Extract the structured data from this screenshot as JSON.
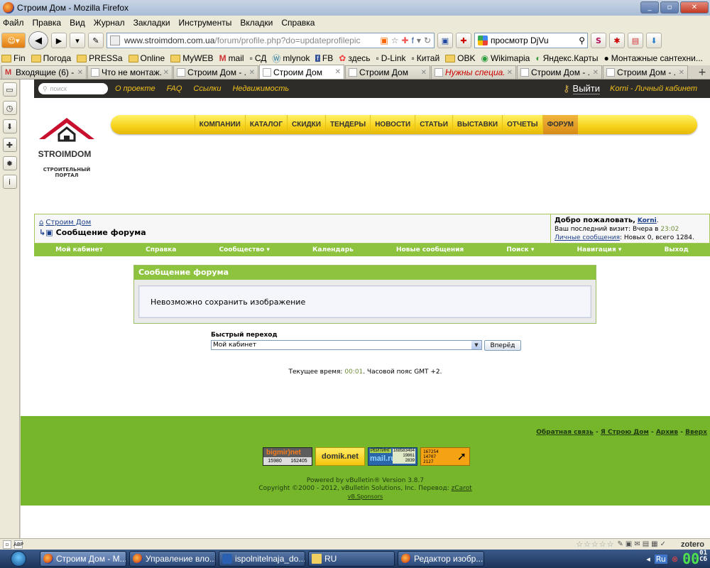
{
  "window": {
    "title": "Строим Дом - Mozilla Firefox"
  },
  "menubar": [
    "Файл",
    "Правка",
    "Вид",
    "Журнал",
    "Закладки",
    "Инструменты",
    "Вкладки",
    "Справка"
  ],
  "navbar": {
    "url_host": "www.stroimdom.com.ua",
    "url_path": "/forum/profile.php?do=updateprofilepic",
    "search_value": "просмотр DjVu"
  },
  "bookmarks": [
    "Fin",
    "Погода",
    "PRESSa",
    "Online",
    "MyWEB",
    "mail",
    "СД",
    "mlynok",
    "FB",
    "здесь",
    "D-Link",
    "Китай",
    "OBK",
    "Wikimapia",
    "Яндекс.Карты",
    "Монтажные сантехни..."
  ],
  "tabs": [
    {
      "label": "Входящие (6) - ...",
      "icon": "gmail-icon",
      "active": false,
      "red": false
    },
    {
      "label": "Что не монтаж...",
      "icon": "page-icon",
      "active": false,
      "red": false
    },
    {
      "label": "Строим Дом - ...",
      "icon": "page-icon",
      "active": false,
      "red": false
    },
    {
      "label": "Строим Дом",
      "icon": "page-icon",
      "active": true,
      "red": false
    },
    {
      "label": "Строим Дом",
      "icon": "page-icon",
      "active": false,
      "red": false
    },
    {
      "label": "Нужны специа...",
      "icon": "page-icon",
      "active": false,
      "red": true
    },
    {
      "label": "Строим Дом - ...",
      "icon": "page-icon",
      "active": false,
      "red": false
    },
    {
      "label": "Строим Дом - ...",
      "icon": "page-icon",
      "active": false,
      "red": false
    }
  ],
  "site": {
    "top": {
      "search_placeholder": "поиск",
      "links": [
        "О проекте",
        "FAQ",
        "Ссылки",
        "Недвижимость"
      ],
      "exit": "Выйти",
      "cabinet": "Korni - Личный кабинет"
    },
    "logo": {
      "brand": "STROIMDOM",
      "sub": "СТРОИТЕЛЬНЫЙ ПОРТАЛ"
    },
    "menu": [
      "КОМПАНИИ",
      "КАТАЛОГ",
      "СКИДКИ",
      "ТЕНДЕРЫ",
      "НОВОСТИ",
      "СТАТЬИ",
      "ВЫСТАВКИ",
      "ОТЧЕТЫ",
      "ФОРУМ"
    ],
    "menu_active": "ФОРУМ"
  },
  "forum": {
    "breadcrumb_home": "Строим Дом",
    "breadcrumb_current": "Сообщение форума",
    "welcome_prefix": "Добро пожаловать,",
    "username": "Korni",
    "last_visit_label": "Ваш последний визит: Вчера в",
    "last_visit_time": "23:02",
    "pm_link": "Личные сообщения",
    "pm_text": ": Новых 0, всего 1284.",
    "nav": [
      "Мой кабинет",
      "Справка",
      "Сообщество ▾",
      "Календарь",
      "Новые сообщения",
      "Поиск ▾",
      "Навигация ▾",
      "Выход"
    ],
    "message_title": "Сообщение форума",
    "message_text": "Невозможно сохранить изображение",
    "quick_jump_label": "Быстрый переход",
    "quick_jump_value": "Мой кабинет",
    "quick_jump_button": "Вперёд",
    "time_prefix": "Текущее время:",
    "time_value": "00:01",
    "time_suffix": ". Часовой пояс GMT +2."
  },
  "footer": {
    "links": [
      "Обратная связь",
      "Я Строю Дом",
      "Архив",
      "Вверх"
    ],
    "counters": {
      "bigmir": {
        "title": "bigmir)net",
        "a": "15980",
        "b": "162405"
      },
      "domik": "domik.net",
      "mail": {
        "tag": "РЕЙТИНГ",
        "brand": "mail.ru",
        "a": "168583494",
        "b": "19861",
        "c": "2839"
      },
      "li": {
        "a": "167254",
        "b": "14707",
        "c": "2127"
      }
    },
    "powered": "Powered by vBulletin® Version 3.8.7",
    "copyright": "Copyright ©2000 - 2012, vBulletin Solutions, Inc. Перевод:",
    "translator": "zCarot",
    "sponsors": "vB.Sponsors"
  },
  "statusbar": {
    "zotero": "zotero"
  },
  "taskbar": {
    "tasks": [
      {
        "label": "Строим Дом - М...",
        "icon": "firefox",
        "active": true
      },
      {
        "label": "Управление вло...",
        "icon": "firefox",
        "active": false
      },
      {
        "label": "ispolnitelnaja_do...",
        "icon": "word",
        "active": false
      },
      {
        "label": "RU",
        "icon": "folder",
        "active": false
      },
      {
        "label": "Редактор изобр...",
        "icon": "firefox",
        "active": false
      }
    ],
    "lang": "Ru",
    "clock": "00",
    "clock_min": "01",
    "clock_day": "Сб"
  }
}
